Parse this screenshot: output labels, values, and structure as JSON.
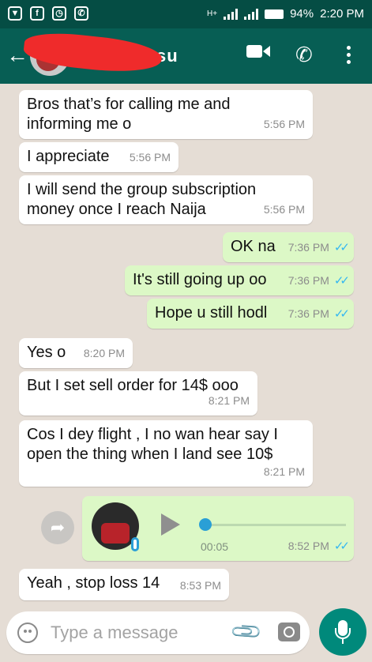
{
  "status_bar": {
    "network": "H+",
    "battery": "94%",
    "time": "2:20 PM"
  },
  "header": {
    "contact_name": "su"
  },
  "messages": [
    {
      "dir": "in",
      "text_line1": "Bros that’s for calling me and",
      "text_line2": "informing me o",
      "time": "5:56 PM"
    },
    {
      "dir": "in",
      "text_line1": "I appreciate",
      "time": "5:56 PM"
    },
    {
      "dir": "in",
      "text_line1": "I will send the group subscription",
      "text_line2": "money once I reach Naija",
      "time": "5:56 PM"
    },
    {
      "dir": "out",
      "text_line1": "OK na",
      "time": "7:36 PM",
      "ticks": "✓✓"
    },
    {
      "dir": "out",
      "text_line1": "It's still going up oo",
      "time": "7:36 PM",
      "ticks": "✓✓"
    },
    {
      "dir": "out",
      "text_line1": "Hope u still hodl",
      "time": "7:36 PM",
      "ticks": "✓✓"
    },
    {
      "dir": "in",
      "text_line1": "Yes o",
      "time": "8:20 PM"
    },
    {
      "dir": "in",
      "text_line1": "But I set sell order for 14$ ooo",
      "time": "8:21 PM"
    },
    {
      "dir": "in",
      "text_line1": "Cos I dey flight , I no wan hear say I",
      "text_line2": "open the thing when I land see 10$",
      "time": "8:21 PM"
    },
    {
      "dir": "in",
      "text_line1": "Yeah , stop loss 14",
      "time": "8:53 PM"
    }
  ],
  "voice_message": {
    "duration": "00:05",
    "time": "8:52 PM",
    "ticks": "✓✓",
    "progress": 0
  },
  "input": {
    "placeholder": "Type a message"
  }
}
